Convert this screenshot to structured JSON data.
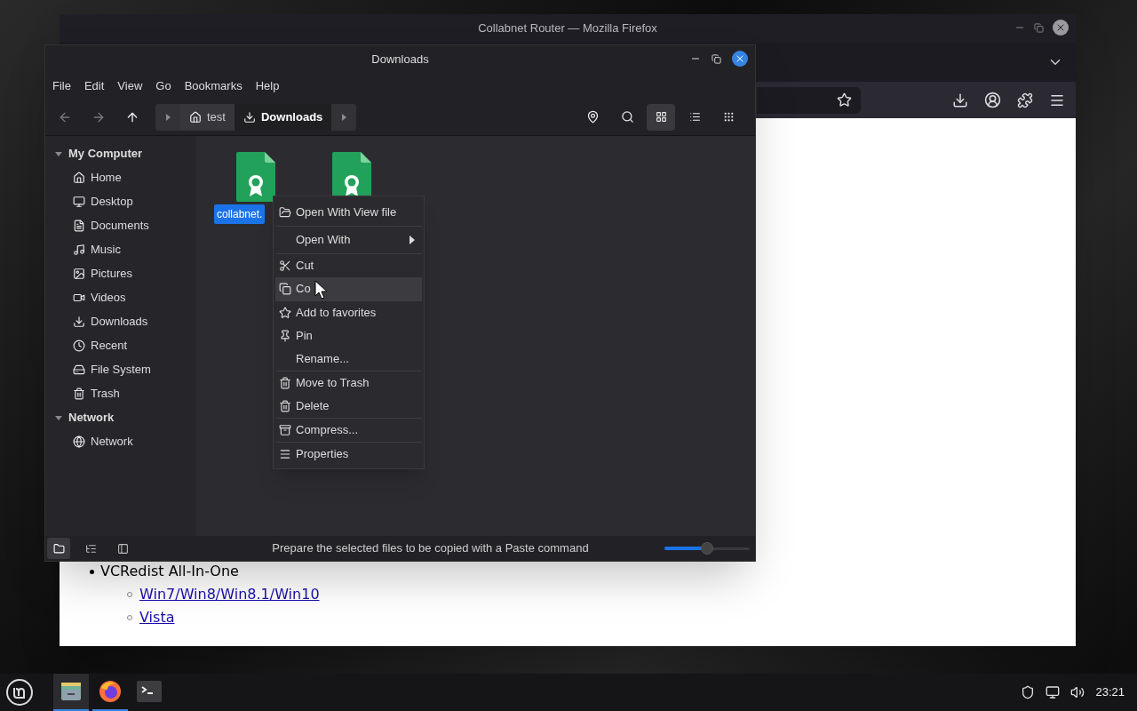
{
  "browser": {
    "title": "Collabnet Router — Mozilla Firefox",
    "content": {
      "heading": "VCRedist All-In-One",
      "links": [
        "Win7/Win8/Win8.1/Win10",
        "Vista"
      ]
    }
  },
  "file_manager": {
    "title": "Downloads",
    "menu": [
      "File",
      "Edit",
      "View",
      "Go",
      "Bookmarks",
      "Help"
    ],
    "breadcrumbs": [
      {
        "label": "test",
        "selected": false
      },
      {
        "label": "Downloads",
        "selected": true
      }
    ],
    "view_modes": [
      {
        "selected": true
      },
      {
        "selected": false
      },
      {
        "selected": false
      }
    ],
    "sidebar": [
      {
        "label": "My Computer",
        "expanded": true,
        "children": [
          {
            "label": "Home"
          },
          {
            "label": "Desktop"
          },
          {
            "label": "Documents"
          },
          {
            "label": "Music"
          },
          {
            "label": "Pictures"
          },
          {
            "label": "Videos"
          },
          {
            "label": "Downloads"
          },
          {
            "label": "Recent"
          },
          {
            "label": "File System"
          },
          {
            "label": "Trash"
          }
        ]
      },
      {
        "label": "Network",
        "expanded": true,
        "children": [
          {
            "label": "Network"
          }
        ]
      }
    ],
    "files": [
      {
        "kind": "certificate",
        "name": "collabnet.",
        "selected": true
      },
      {
        "kind": "certificate"
      }
    ],
    "status_panes": [
      {
        "selected": true
      },
      {
        "selected": false
      },
      {
        "selected": false
      }
    ],
    "status": "Prepare the selected files to be copied with a Paste command",
    "zoom": {
      "level": 0.5
    }
  },
  "context_menu": [
    [
      {
        "label": "Open With View file",
        "kind": "item",
        "selected": false
      }
    ],
    [
      {
        "label": "Open With",
        "kind": "submenu",
        "selected": false
      }
    ],
    [
      {
        "label": "Cut",
        "kind": "item",
        "selected": false
      },
      {
        "label": "Co",
        "kind": "item",
        "selected": true
      }
    ],
    [
      {
        "label": "Add to favorites",
        "kind": "item",
        "selected": false
      },
      {
        "label": "Pin",
        "kind": "item",
        "selected": false
      },
      {
        "label": "Rename...",
        "kind": "item",
        "selected": false
      }
    ],
    [
      {
        "label": "Move to Trash",
        "kind": "item",
        "selected": false
      },
      {
        "label": "Delete",
        "kind": "item",
        "selected": false
      }
    ],
    [
      {
        "label": "Compress...",
        "kind": "item",
        "selected": false
      }
    ],
    [
      {
        "label": "Properties",
        "kind": "item",
        "selected": false
      }
    ]
  ],
  "taskbar": {
    "apps": [
      {
        "active": true
      },
      {
        "active": true
      },
      {
        "active": false
      }
    ],
    "clock": "23:21"
  }
}
